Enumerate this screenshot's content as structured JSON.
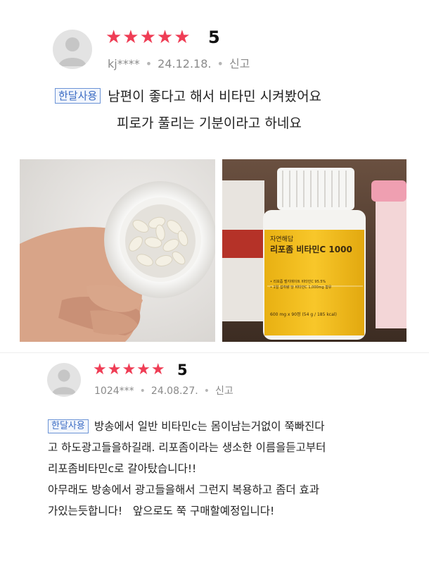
{
  "reviews": [
    {
      "stars": "★★★★★",
      "score": "5",
      "user": "kj****",
      "date": "24.12.18.",
      "report": "신고",
      "tag": "한달사용",
      "lines": [
        "남편이 좋다고 해서 비타민 시켜봤어요",
        "피로가 풀리는 기분이라고 하네요"
      ]
    },
    {
      "stars": "★★★★★",
      "score": "5",
      "user": "1024***",
      "date": "24.08.27.",
      "report": "신고",
      "tag": "한달사용",
      "lines": [
        "방송에서 일반 비타민c는 몸이남는거없이 쭉빠진다",
        "고 하도광고들을하길래. 리포좀이라는 생소한 이름을듣고부터",
        "리포좀비타민c로 갈아탔습니다!!",
        "아무래도 방송에서 광고들을해서 그런지 복용하고 좀더 효과",
        "가있는듯합니다!   앞으로도 쭉 구매할예정입니다!"
      ]
    }
  ],
  "product_label": {
    "brand": "자연해답",
    "name": "리포좀 비타민C 1000",
    "detail1": "• 리포좀 벨지에이트 비타민C 95.5%",
    "detail2": "• 1일 섭취량 당 비타민C 1,000mg 함유",
    "weight": "600 mg x 90정 (54 g / 185 kcal)"
  },
  "colors": {
    "star": "#ef3d55",
    "tag_border": "#6b93d6",
    "label_yellow": "#f6c321"
  }
}
